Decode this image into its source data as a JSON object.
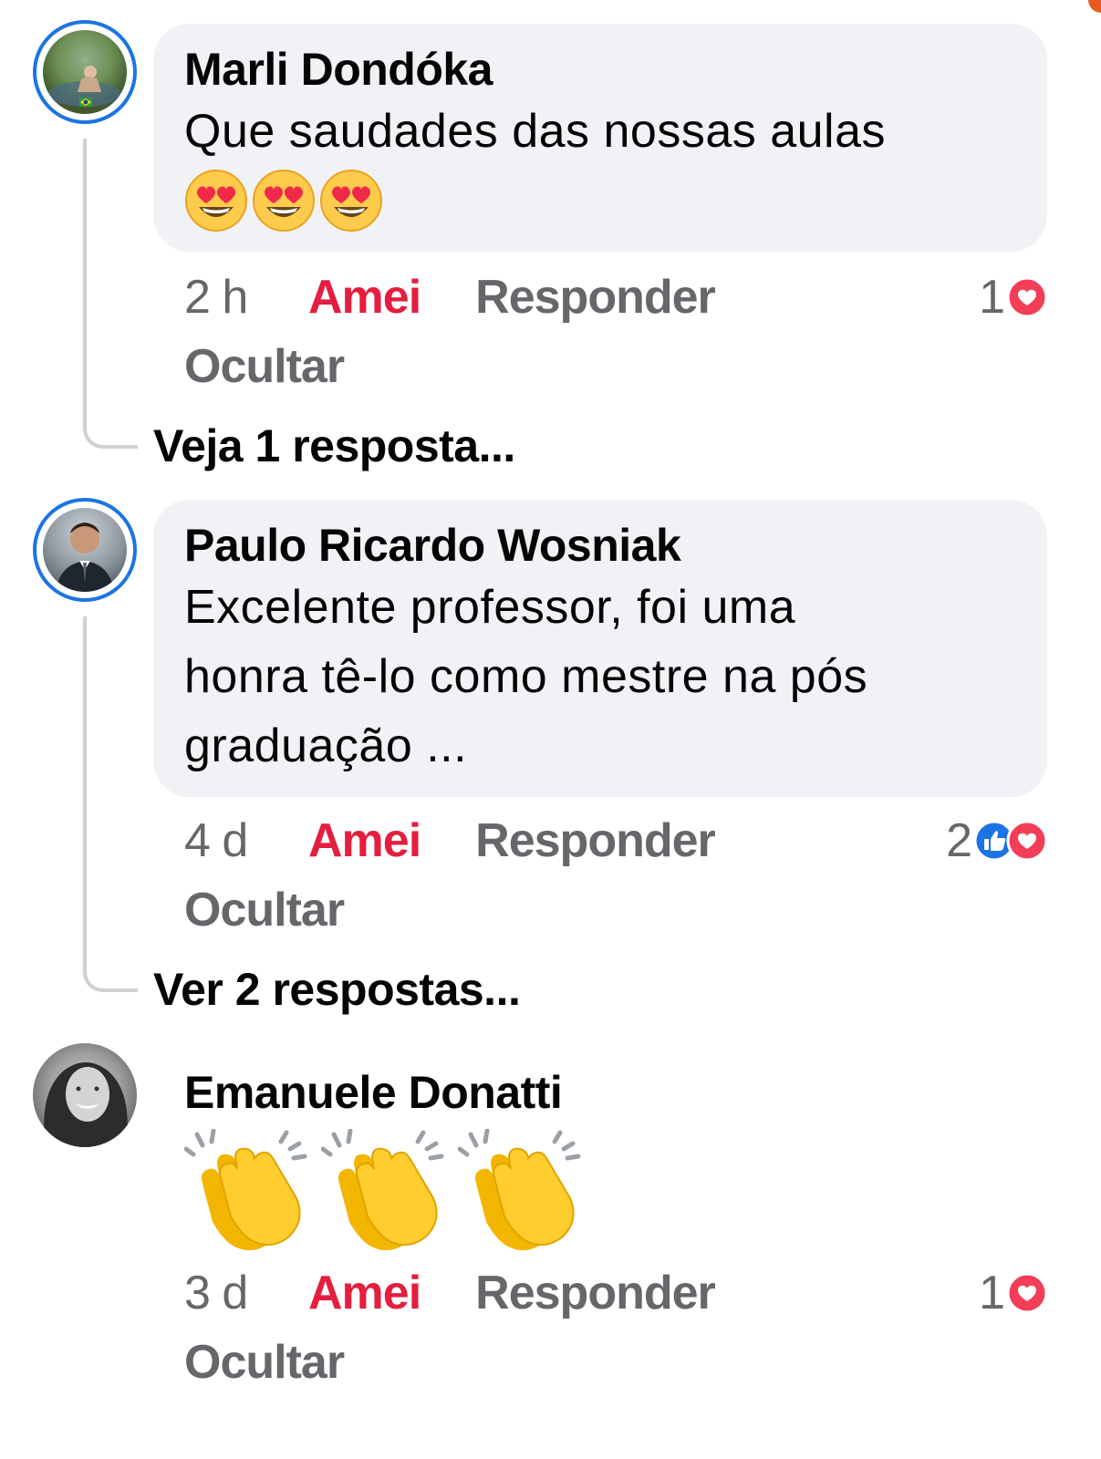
{
  "colors": {
    "accent_ring": "#1b74e4",
    "amei_red": "#e41e3f",
    "bubble_bg": "#f0f2f5",
    "meta_gray": "#65676b"
  },
  "comments": [
    {
      "author": "Marli Dondóka",
      "text": "Que saudades das nossas aulas",
      "emoji": [
        "heart-eyes-emoji",
        "heart-eyes-emoji",
        "heart-eyes-emoji"
      ],
      "time": "2 h",
      "amei_label": "Amei",
      "reply_label": "Responder",
      "hide_label": "Ocultar",
      "reaction_count": "1",
      "reaction_icons": [
        "love-reaction-icon"
      ],
      "replies_link": "Veja 1 resposta..."
    },
    {
      "author": "Paulo Ricardo Wosniak",
      "text_lines": [
        "Excelente professor, foi uma",
        "honra tê-lo como mestre na pós",
        "graduação  ..."
      ],
      "time": "4 d",
      "amei_label": "Amei",
      "reply_label": "Responder",
      "hide_label": "Ocultar",
      "reaction_count": "2",
      "reaction_icons": [
        "like-reaction-icon",
        "love-reaction-icon"
      ],
      "replies_link": "Ver 2 respostas..."
    },
    {
      "author": "Emanuele Donatti",
      "emoji": [
        "clapping-hands-emoji",
        "clapping-hands-emoji",
        "clapping-hands-emoji"
      ],
      "time": "3 d",
      "amei_label": "Amei",
      "reply_label": "Responder",
      "hide_label": "Ocultar",
      "reaction_count": "1",
      "reaction_icons": [
        "love-reaction-icon"
      ]
    }
  ]
}
